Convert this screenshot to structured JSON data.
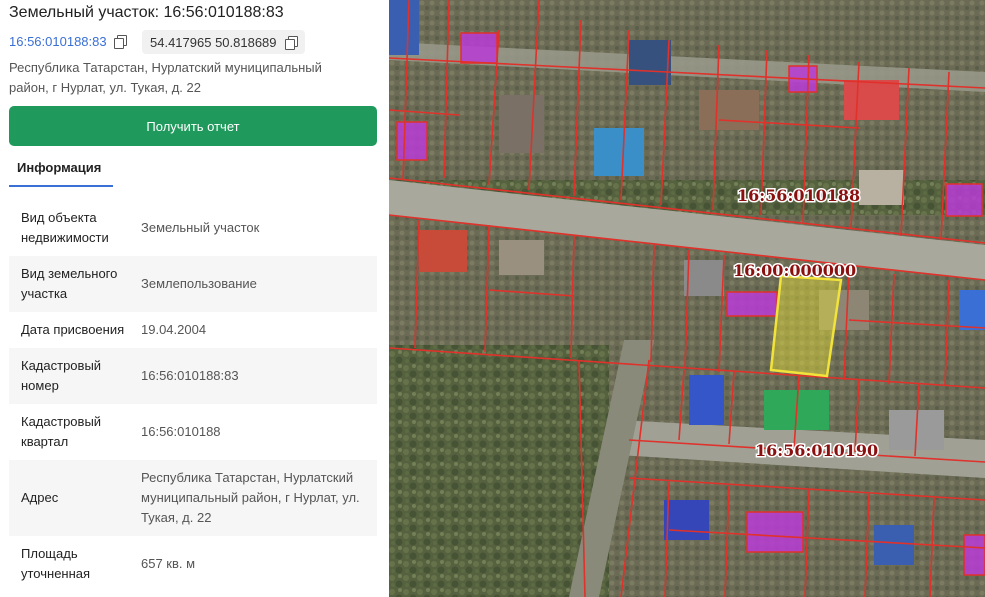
{
  "header": {
    "title": "Земельный участок: 16:56:010188:83",
    "cadastral_link": "16:56:010188:83",
    "coordinates": "54.417965 50.818689",
    "address": "Республика Татарстан, Нурлатский муниципальный район, г Нурлат, ул. Тукая, д. 22"
  },
  "actions": {
    "report_button": "Получить отчет"
  },
  "tabs": [
    {
      "label": "Информация"
    }
  ],
  "info": [
    {
      "key": "Вид объекта недвижимости",
      "value": "Земельный участок"
    },
    {
      "key": "Вид земельного участка",
      "value": "Землепользование"
    },
    {
      "key": "Дата присвоения",
      "value": "19.04.2004"
    },
    {
      "key": "Кадастровый номер",
      "value": "16:56:010188:83"
    },
    {
      "key": "Кадастровый квартал",
      "value": "16:56:010188"
    },
    {
      "key": "Адрес",
      "value": "Республика Татарстан, Нурлатский муниципальный район, г Нурлат, ул. Тукая, д. 22"
    },
    {
      "key": "Площадь уточненная",
      "value": "657 кв. м"
    }
  ],
  "map": {
    "labels": [
      "16:56:010188",
      "16:00:000000",
      "16:56:010190"
    ],
    "colors": {
      "boundary": "#e0312b",
      "selected_fill": "#e8e23a",
      "building_fill": "#b83cd6",
      "label_text": "#8a1010",
      "accent": "#1f9a5c",
      "link": "#3a6fd6"
    },
    "icons": [
      "copy-icon"
    ]
  }
}
